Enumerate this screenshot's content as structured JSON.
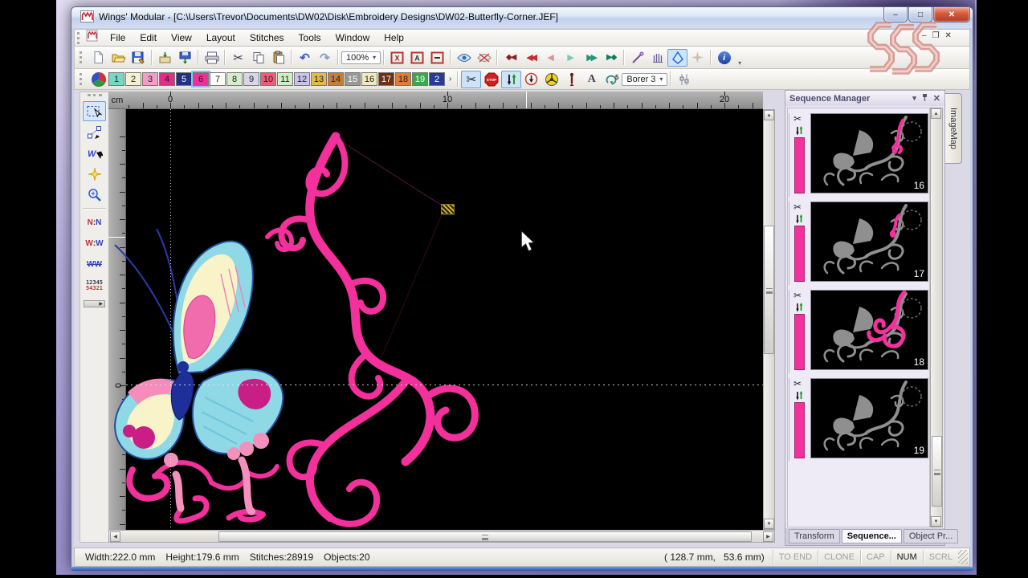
{
  "window": {
    "title": "Wings' Modular - [C:\\Users\\Trevor\\Documents\\DW02\\Disk\\Embroidery Designs\\DW02-Butterfly-Corner.JEF]"
  },
  "menu": {
    "items": [
      "File",
      "Edit",
      "View",
      "Layout",
      "Stitches",
      "Tools",
      "Window",
      "Help"
    ]
  },
  "toolbar_main": {
    "zoom_value": "100%",
    "buttons": [
      "new",
      "open",
      "save",
      "|",
      "send-to-machine",
      "save-to-disk",
      "|",
      "print",
      "|",
      "cut",
      "copy",
      "paste",
      "|",
      "undo",
      "redo",
      "|",
      "zoom-select",
      "|",
      "hoop-x",
      "hoop-a",
      "hoop-limit",
      "|",
      "show-stitches",
      "hide-stitches",
      "|",
      "nav-first",
      "nav-prev-fast",
      "nav-prev",
      "nav-next",
      "nav-next-fast",
      "nav-last",
      "|",
      "stitch-pen",
      "density-comb",
      "fill-shape",
      "auto-sparkle",
      "|",
      "info"
    ],
    "active": [
      "fill-shape"
    ]
  },
  "palette": {
    "swatches": [
      {
        "label": "1",
        "color": "#76d7c2"
      },
      {
        "label": "2",
        "color": "#f6f0d0"
      },
      {
        "label": "3",
        "color": "#f29cc6"
      },
      {
        "label": "4",
        "color": "#de2e86"
      },
      {
        "label": "5",
        "color": "#22337e",
        "light": true
      },
      {
        "label": "6",
        "color": "#f03095",
        "selected": true
      },
      {
        "label": "7",
        "color": "#fdfdfb"
      },
      {
        "label": "8",
        "color": "#d6ecca"
      },
      {
        "label": "9",
        "color": "#d9d5e8"
      },
      {
        "label": "10",
        "color": "#ee5c78"
      },
      {
        "label": "11",
        "color": "#cfeec4"
      },
      {
        "label": "12",
        "color": "#cac2ec"
      },
      {
        "label": "13",
        "color": "#e2bc4a"
      },
      {
        "label": "14",
        "color": "#c08038"
      },
      {
        "label": "15",
        "color": "#989898",
        "light": true
      },
      {
        "label": "16",
        "color": "#f0eabe"
      },
      {
        "label": "17",
        "color": "#6e3018",
        "light": true
      },
      {
        "label": "18",
        "color": "#dd7e34"
      },
      {
        "label": "19",
        "color": "#3aa84c",
        "light": true
      },
      {
        "label": "2",
        "color": "#283c96",
        "light": true
      }
    ],
    "more_symbol": "›"
  },
  "stitch_tools": {
    "borer_label": "Borer 3",
    "buttons": [
      "scissors-trim",
      "stop-command",
      "needle-points",
      "trim-circle",
      "spoke-wheel",
      "needle",
      "lettering-a",
      "repeat-5",
      "borer-select",
      "|",
      "slider"
    ],
    "active": [
      "scissors-trim",
      "needle-points"
    ]
  },
  "toolbox": {
    "buttons": [
      "select",
      "node-edit",
      "stitch-insert",
      "magic-star",
      "zoom-tool",
      "|",
      "nn-compare",
      "ww-compare",
      "www-lines",
      "stitch-numbers"
    ],
    "active": [
      "select"
    ]
  },
  "ruler": {
    "unit": "cm",
    "h_labels": [
      "0",
      "10",
      "20"
    ],
    "v_label": "0"
  },
  "sequence_manager": {
    "title": "Sequence Manager",
    "thread_color": "#f3309b",
    "items": [
      {
        "number": "16",
        "highlight": "a"
      },
      {
        "number": "17",
        "highlight": "b"
      },
      {
        "number": "18",
        "highlight": "c"
      },
      {
        "number": "19",
        "highlight": "none"
      }
    ],
    "tabs": [
      {
        "label": "Transform",
        "active": false
      },
      {
        "label": "Sequence...",
        "active": true
      },
      {
        "label": "Object Pr...",
        "active": false
      }
    ]
  },
  "imagemap_label": "ImageMap",
  "status": {
    "width": "Width:222.0 mm",
    "height": "Height:179.6 mm",
    "stitches": "Stitches:28919",
    "objects": "Objects:20",
    "coords": "( 128.7 mm,   53.6 mm)",
    "indicators": [
      {
        "label": "TO END",
        "active": false
      },
      {
        "label": "CLONE",
        "active": false
      },
      {
        "label": "CAP",
        "active": false
      },
      {
        "label": "NUM",
        "active": true
      },
      {
        "label": "SCRL",
        "active": false
      }
    ]
  },
  "watermark": "SSS",
  "colors": {
    "design_pink": "#f3309b",
    "canvas_bg": "#000000"
  }
}
